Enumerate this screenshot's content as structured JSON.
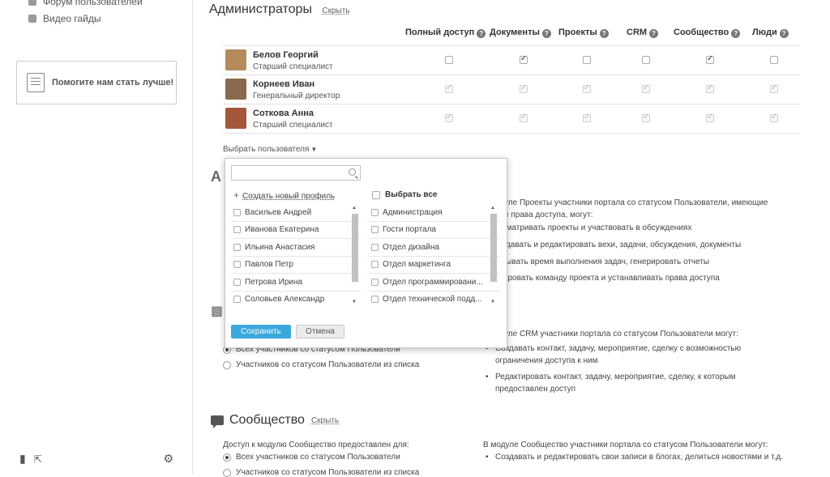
{
  "sidebar": {
    "links": [
      {
        "label": "Форум пользователей"
      },
      {
        "label": "Видео гайды"
      }
    ],
    "promo": "Помогите нам стать лучше!"
  },
  "admins": {
    "title": "Администраторы",
    "hide": "Скрыть",
    "columns": [
      {
        "label": "Полный доступ"
      },
      {
        "label": "Документы"
      },
      {
        "label": "Проекты"
      },
      {
        "label": "CRM"
      },
      {
        "label": "Сообщество"
      },
      {
        "label": "Люди"
      }
    ],
    "users": [
      {
        "name": "Белов Георгий",
        "position": "Старший специалист",
        "avatar_color": "#b58b5c",
        "checks": [
          false,
          true,
          false,
          false,
          true,
          false
        ],
        "disabled": false
      },
      {
        "name": "Корнеев Иван",
        "position": "Генеральный директор",
        "avatar_color": "#8a6a4e",
        "checks": [
          true,
          true,
          true,
          true,
          true,
          true
        ],
        "disabled": true
      },
      {
        "name": "Соткова Анна",
        "position": "Старший специалист",
        "avatar_color": "#a4573a",
        "checks": [
          true,
          true,
          true,
          true,
          true,
          true
        ],
        "disabled": true
      }
    ],
    "select_user": "Выбрать пользователя"
  },
  "popup": {
    "search_placeholder": "",
    "create_profile": "Создать новый профиль",
    "select_all": "Выбрать все",
    "people": [
      "Васильев Андрей",
      "Иванова Екатерина",
      "Ильина Анастасия",
      "Павлов Петр",
      "Петрова Ирина",
      "Соловьев Александр"
    ],
    "groups": [
      "Администрация",
      "Гости портала",
      "Отдел дизайна",
      "Отдел маркетинга",
      "Отдел программировани...",
      "Отдел технической подд..."
    ],
    "save": "Сохранить",
    "cancel": "Отмена"
  },
  "projects": {
    "desc_line1": "уле Проекты участники портала со статусом Пользователи, имеющие",
    "desc_line2": "е права доступа, могут:",
    "bullets": [
      "осматривать проекты и участвовать в обсуждениях",
      "оздавать и редактировать вехи, задачи, обсуждения, документы",
      "итывать время выполнения задач, генерировать отчеты",
      "мировать команду проекта и устанавливать права доступа"
    ]
  },
  "crm": {
    "desc": "уле CRM участники портала со статусом Пользователи могут:",
    "radio_all": "Всех участников со статусом Пользователи",
    "radio_list": "Участников со статусом Пользователи из списка",
    "bullets": [
      "Создавать контакт, задачу, мероприятие, сделку с возможностью ограничения доступа к ним",
      "Редактировать контакт, задачу, мероприятие, сделку, к которым предоставлен доступ"
    ]
  },
  "community": {
    "title": "Сообщество",
    "hide": "Скрыть",
    "access_label": "Доступ к модулю Сообщество предоставлен для:",
    "radio_all": "Всех участников со статусом Пользователи",
    "radio_list": "Участников со статусом Пользователи из списка",
    "right_label": "В модуле Сообщество участники портала со статусом Пользователи могут:",
    "bullet": "Создавать и редактировать свои записи в блогах, делиться новостями и т.д."
  }
}
